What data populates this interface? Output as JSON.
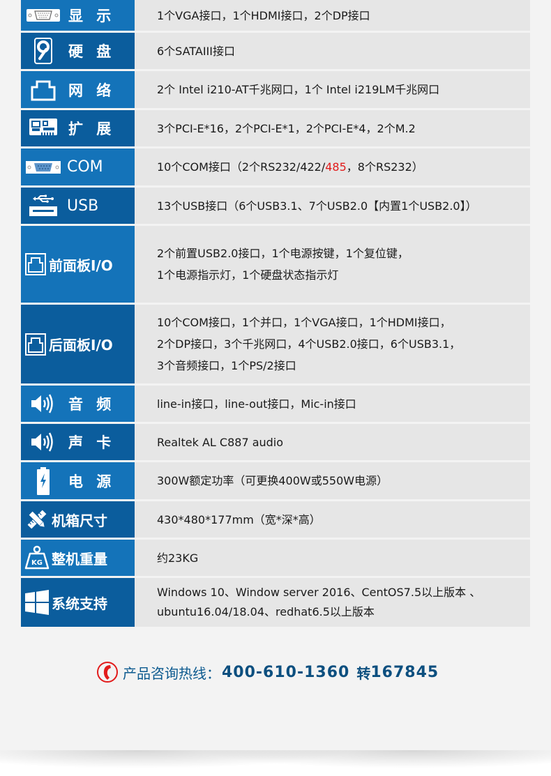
{
  "specs": [
    {
      "label": "显 示",
      "icon": "vga-port-icon",
      "shade": "light",
      "lines": [
        "1个VGA接口，1个HDMI接口，2个DP接口"
      ]
    },
    {
      "label": "硬 盘",
      "icon": "hard-disk-icon",
      "shade": "dark",
      "lines": [
        "6个SATAIII接口"
      ]
    },
    {
      "label": "网 络",
      "icon": "ethernet-port-icon",
      "shade": "light",
      "lines": [
        "2个 Intel i210-AT千兆网口，1个 Intel i219LM千兆网口"
      ]
    },
    {
      "label": "扩 展",
      "icon": "expansion-card-icon",
      "shade": "dark",
      "lines": [
        "3个PCI-E*16，2个PCI-E*1，2个PCI-E*4，2个M.2"
      ]
    },
    {
      "label": "COM",
      "icon": "serial-port-icon",
      "shade": "light",
      "lines": [
        "10个COM接口（2个RS232/422/",
        "485",
        "，8个RS232）"
      ],
      "highlight": "485",
      "highlight_color": "#e21b1b"
    },
    {
      "label": "USB",
      "icon": "usb-icon",
      "shade": "dark",
      "lines": [
        "13个USB接口（6个USB3.1、7个USB2.0【内置1个USB2.0】）"
      ]
    },
    {
      "label": "前面板I/O",
      "icon": "panel-port-icon",
      "shade": "light",
      "lines": [
        "2个前置USB2.0接口，1个电源按键，1个复位键，",
        "1个电源指示灯，1个硬盘状态指示灯"
      ]
    },
    {
      "label": "后面板I/O",
      "icon": "panel-port-icon",
      "shade": "dark",
      "lines": [
        "10个COM接口，1个并口，1个VGA接口，1个HDMI接口，",
        "2个DP接口，3个千兆网口，4个USB2.0接口，6个USB3.1，",
        "3个音频接口，1个PS/2接口"
      ]
    },
    {
      "label": "音 频",
      "icon": "speaker-icon",
      "shade": "light",
      "lines": [
        "line-in接口，line-out接口，Mic-in接口"
      ]
    },
    {
      "label": "声 卡",
      "icon": "speaker-icon",
      "shade": "dark",
      "lines": [
        "Realtek AL C887 audio"
      ]
    },
    {
      "label": "电 源",
      "icon": "battery-icon",
      "shade": "light",
      "lines": [
        "300W额定功率（可更换400W或550W电源）"
      ]
    },
    {
      "label": "机箱尺寸",
      "icon": "ruler-pencil-icon",
      "shade": "dark",
      "lines": [
        "430*480*177mm（宽*深*高）"
      ]
    },
    {
      "label": "整机重量",
      "icon": "weight-kg-icon",
      "shade": "light",
      "lines": [
        "约23KG"
      ]
    },
    {
      "label": "系统支持",
      "icon": "windows-logo-icon",
      "shade": "dark",
      "lines": [
        "Windows 10、Window server 2016、CentOS7.5以上版本 、",
        "ubuntu16.04/18.04、redhat6.5以上版本"
      ]
    }
  ],
  "hotline": {
    "label": "产品咨询热线：",
    "number": "400-610-1360",
    "ext_label": "转",
    "ext": "167845",
    "icon": "phone-icon"
  },
  "colors": {
    "label_light": "#1473b9",
    "label_dark": "#0b5d9d",
    "value_bg": "#e6e6e6",
    "page_bg": "#f3f3f3",
    "hotline": "#0c4f7f",
    "highlight_red": "#e21b1b"
  }
}
